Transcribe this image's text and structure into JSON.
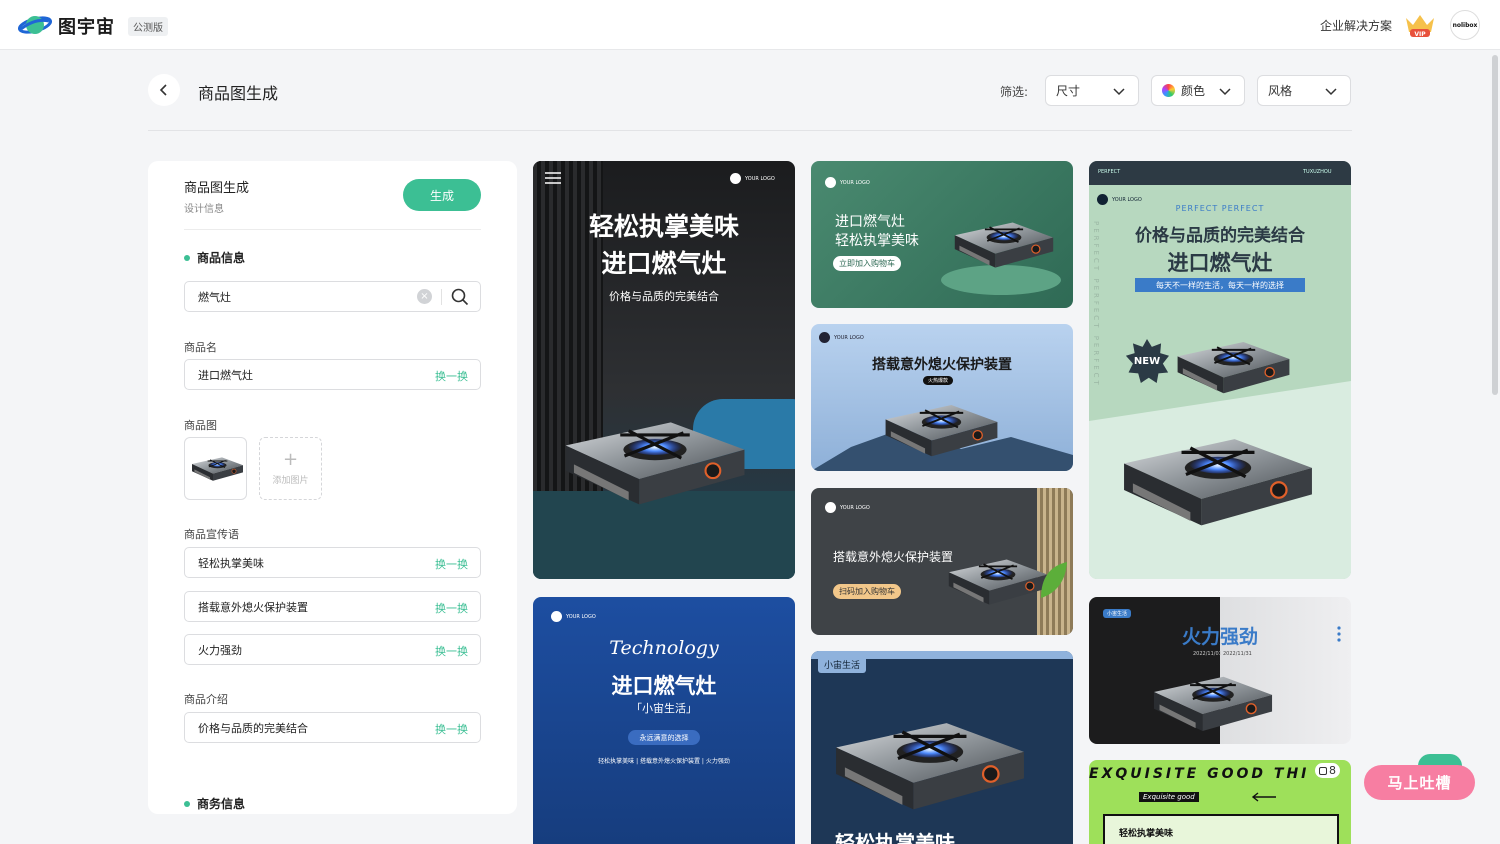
{
  "header": {
    "brand": "图宇宙",
    "beta_badge": "公测版",
    "enterprise_link": "企业解决方案",
    "vip_label": "VIP",
    "avatar_text": "nolibox"
  },
  "titlebar": {
    "title": "商品图生成",
    "filter_label": "筛选:",
    "filters": {
      "size": "尺寸",
      "color": "颜色",
      "style": "风格"
    }
  },
  "panel": {
    "title": "商品图生成",
    "subtitle": "设计信息",
    "generate_label": "生成",
    "product_section": "商品信息",
    "search_value": "燃气灶",
    "name_label": "商品名",
    "name_value": "进口燃气灶",
    "swap_label": "换一换",
    "image_label": "商品图",
    "add_image_label": "添加图片",
    "slogan_label": "商品宣传语",
    "slogans": [
      "轻松执掌美味",
      "搭载意外熄火保护装置",
      "火力强劲"
    ],
    "intro_label": "商品介绍",
    "intro_value": "价格与品质的完美结合",
    "business_section": "商务信息"
  },
  "cards": {
    "logo_text": "YOUR LOGO",
    "c1": {
      "line1": "轻松执掌美味",
      "line2": "进口燃气灶",
      "sub": "价格与品质的完美结合"
    },
    "c2": {
      "line1": "进口燃气灶",
      "line2": "轻松执掌美味",
      "btn": "立即加入购物车"
    },
    "c3": {
      "title": "搭载意外熄火保护装置",
      "tag": "火热爆款"
    },
    "c4": {
      "title": "搭载意外熄火保护装置",
      "btn": "扫码加入购物车"
    },
    "c5": {
      "script": "Technology",
      "title": "进口燃气灶",
      "quote": "「小宙生活」",
      "pill": "永远满意的选择",
      "foot": "轻松执掌美味 | 搭载意外熄火保护装置 | 火力强劲"
    },
    "c6": {
      "tag": "小宙生活",
      "title": "轻松执掌美味"
    },
    "c7": {
      "tag_top": "PERFECT",
      "top_right": "TUXUZHOU",
      "arc": "PERFECT PERFECT",
      "line1": "价格与品质的完美结合",
      "line2": "进口燃气灶",
      "banner": "每天不一样的生活，每天一样的选择",
      "badge": "NEW",
      "side": "PERFECT PERFECT PERFECT"
    },
    "c8": {
      "tag": "小宙生活",
      "title": "火力强劲",
      "date1": "2022/11/01",
      "date2": "2022/11/31"
    },
    "c9": {
      "headline": "EXQUISITE GOOD THI",
      "count": "8",
      "sub": "Exquisite good",
      "label": "轻松执掌美味"
    }
  },
  "feedback_label": "马上吐槽"
}
